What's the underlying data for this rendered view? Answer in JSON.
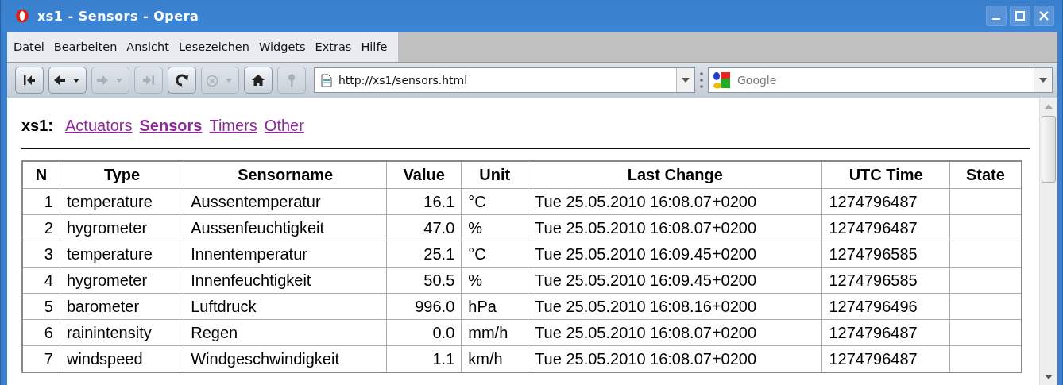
{
  "window": {
    "title": "xs1 - Sensors - Opera"
  },
  "menu": [
    "Datei",
    "Bearbeiten",
    "Ansicht",
    "Lesezeichen",
    "Widgets",
    "Extras",
    "Hilfe"
  ],
  "toolbar": [
    {
      "kind": "rewind",
      "disabled": false,
      "dropdown": false
    },
    {
      "kind": "back",
      "disabled": false,
      "dropdown": true
    },
    {
      "kind": "forward",
      "disabled": true,
      "dropdown": true
    },
    {
      "kind": "fastforward",
      "disabled": true,
      "dropdown": false
    },
    {
      "kind": "reload",
      "disabled": false,
      "dropdown": false
    },
    {
      "kind": "stop",
      "disabled": true,
      "dropdown": true
    },
    {
      "kind": "home",
      "disabled": false,
      "dropdown": false
    },
    {
      "kind": "key",
      "disabled": true,
      "dropdown": false
    }
  ],
  "address": {
    "value": "http://xs1/sensors.html"
  },
  "search": {
    "placeholder": "Google"
  },
  "page": {
    "site": "xs1:",
    "nav": [
      {
        "label": "Actuators",
        "selected": false
      },
      {
        "label": "Sensors",
        "selected": true
      },
      {
        "label": "Timers",
        "selected": false
      },
      {
        "label": "Other",
        "selected": false
      }
    ]
  },
  "table": {
    "columns": [
      "N",
      "Type",
      "Sensorname",
      "Value",
      "Unit",
      "Last Change",
      "UTC Time",
      "State"
    ],
    "rows": [
      [
        "1",
        "temperature",
        "Aussentemperatur",
        "16.1",
        "°C",
        "Tue 25.05.2010 16:08.07+0200",
        "1274796487",
        ""
      ],
      [
        "2",
        "hygrometer",
        "Aussenfeuchtigkeit",
        "47.0",
        "%",
        "Tue 25.05.2010 16:08.07+0200",
        "1274796487",
        ""
      ],
      [
        "3",
        "temperature",
        "Innentemperatur",
        "25.1",
        "°C",
        "Tue 25.05.2010 16:09.45+0200",
        "1274796585",
        ""
      ],
      [
        "4",
        "hygrometer",
        "Innenfeuchtigkeit",
        "50.5",
        "%",
        "Tue 25.05.2010 16:09.45+0200",
        "1274796585",
        ""
      ],
      [
        "5",
        "barometer",
        "Luftdruck",
        "996.0",
        "hPa",
        "Tue 25.05.2010 16:08.16+0200",
        "1274796496",
        ""
      ],
      [
        "6",
        "rainintensity",
        "Regen",
        "0.0",
        "mm/h",
        "Tue 25.05.2010 16:08.07+0200",
        "1274796487",
        ""
      ],
      [
        "7",
        "windspeed",
        "Windgeschwindigkeit",
        "1.1",
        "km/h",
        "Tue 25.05.2010 16:08.07+0200",
        "1274796487",
        ""
      ]
    ]
  }
}
